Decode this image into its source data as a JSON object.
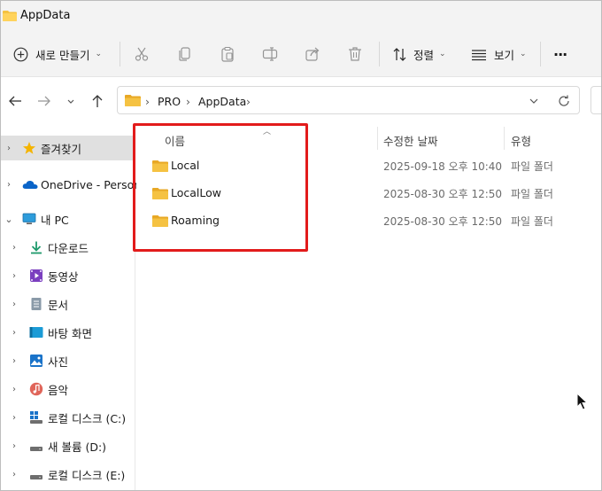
{
  "window": {
    "title": "AppData"
  },
  "toolbar": {
    "new_label": "새로 만들기",
    "sort_label": "정렬",
    "view_label": "보기",
    "more_label": "···"
  },
  "address": {
    "crumbs": [
      "PRO",
      "AppData"
    ]
  },
  "sidebar": {
    "items": [
      {
        "label": "즐겨찾기",
        "icon": "star-icon",
        "selected": true
      },
      {
        "label": "OneDrive - Persona",
        "icon": "cloud-icon"
      },
      {
        "label": "내 PC",
        "icon": "monitor-icon"
      },
      {
        "label": "다운로드",
        "icon": "download-icon"
      },
      {
        "label": "동영상",
        "icon": "video-icon"
      },
      {
        "label": "문서",
        "icon": "document-icon"
      },
      {
        "label": "바탕 화면",
        "icon": "desktop-icon"
      },
      {
        "label": "사진",
        "icon": "picture-icon"
      },
      {
        "label": "음악",
        "icon": "music-icon"
      },
      {
        "label": "로컬 디스크 (C:)",
        "icon": "windows-drive-icon"
      },
      {
        "label": "새 볼륨 (D:)",
        "icon": "drive-icon"
      },
      {
        "label": "로컬 디스크 (E:)",
        "icon": "drive-icon"
      }
    ]
  },
  "columns": {
    "name": "이름",
    "date": "수정한 날짜",
    "type": "유형"
  },
  "files": [
    {
      "name": "Local",
      "date": "2025-09-18 오후 10:40",
      "type": "파일 폴더"
    },
    {
      "name": "LocalLow",
      "date": "2025-08-30 오후 12:50",
      "type": "파일 폴더"
    },
    {
      "name": "Roaming",
      "date": "2025-08-30 오후 12:50",
      "type": "파일 폴더"
    }
  ],
  "colors": {
    "highlight": "#e21b1b",
    "folder": "#f5c242",
    "accent": "#0a64c8"
  }
}
